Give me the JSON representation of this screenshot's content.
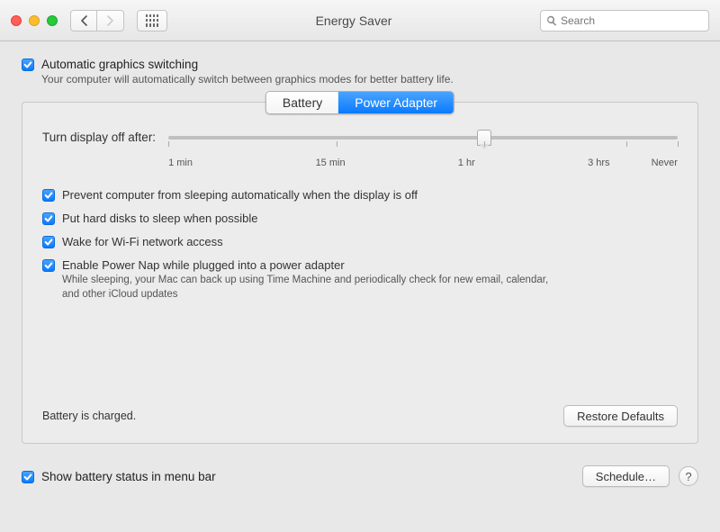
{
  "window": {
    "title": "Energy Saver"
  },
  "search": {
    "placeholder": "Search"
  },
  "auto_gfx": {
    "label": "Automatic graphics switching",
    "sub": "Your computer will automatically switch between graphics modes for better battery life.",
    "checked": true
  },
  "tabs": {
    "battery": "Battery",
    "power_adapter": "Power Adapter",
    "active": "power_adapter"
  },
  "slider": {
    "label": "Turn display off after:",
    "ticks": {
      "t0": "1 min",
      "t1": "15 min",
      "t2": "1 hr",
      "t3": "3 hrs",
      "t4": "Never"
    },
    "value_pct": 62
  },
  "opts": {
    "prevent_sleep": {
      "label": "Prevent computer from sleeping automatically when the display is off",
      "checked": true
    },
    "hdd_sleep": {
      "label": "Put hard disks to sleep when possible",
      "checked": true
    },
    "wake_wifi": {
      "label": "Wake for Wi-Fi network access",
      "checked": true
    },
    "power_nap": {
      "label": "Enable Power Nap while plugged into a power adapter",
      "sub": "While sleeping, your Mac can back up using Time Machine and periodically check for new email, calendar, and other iCloud updates",
      "checked": true
    }
  },
  "status": "Battery is charged.",
  "buttons": {
    "restore": "Restore Defaults",
    "schedule": "Schedule…"
  },
  "menu_bar": {
    "label": "Show battery status in menu bar",
    "checked": true
  },
  "help": "?"
}
